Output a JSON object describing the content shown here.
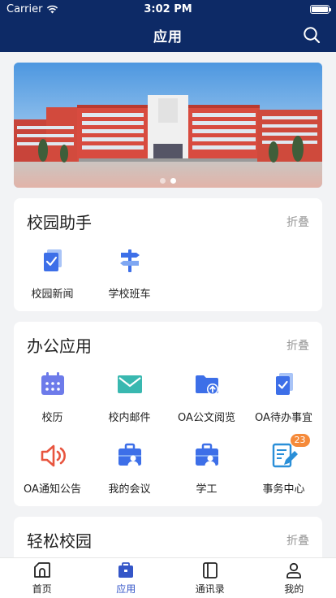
{
  "status_bar": {
    "carrier": "Carrier",
    "time": "3:02 PM"
  },
  "header": {
    "title": "应用"
  },
  "banner": {
    "dots": 2,
    "active_dot": 1
  },
  "sections": [
    {
      "title": "校园助手",
      "fold_label": "折叠",
      "items": [
        {
          "label": "校园新闻",
          "icon": "news-icon"
        },
        {
          "label": "学校班车",
          "icon": "signpost-icon"
        }
      ]
    },
    {
      "title": "办公应用",
      "fold_label": "折叠",
      "items": [
        {
          "label": "校历",
          "icon": "calendar-icon"
        },
        {
          "label": "校内邮件",
          "icon": "mail-icon"
        },
        {
          "label": "OA公文阅览",
          "icon": "folder-upload-icon"
        },
        {
          "label": "OA待办事宜",
          "icon": "todo-check-icon"
        },
        {
          "label": "OA通知公告",
          "icon": "speaker-icon"
        },
        {
          "label": "我的会议",
          "icon": "briefcase-user-icon"
        },
        {
          "label": "学工",
          "icon": "briefcase-user-icon"
        },
        {
          "label": "事务中心",
          "icon": "edit-document-icon",
          "badge": "23"
        }
      ]
    },
    {
      "title": "轻松校园",
      "fold_label": "折叠",
      "items": []
    }
  ],
  "tabs": [
    {
      "label": "首页",
      "icon": "home-icon",
      "active": false
    },
    {
      "label": "应用",
      "icon": "apps-briefcase-icon",
      "active": true
    },
    {
      "label": "通讯录",
      "icon": "contacts-book-icon",
      "active": false
    },
    {
      "label": "我的",
      "icon": "user-icon",
      "active": false
    }
  ],
  "colors": {
    "header_bg": "#0d2a66",
    "accent_blue": "#3d6fe8",
    "accent_teal": "#39b8b0",
    "accent_red": "#e8553f",
    "badge": "#f58a3a",
    "tab_active": "#3456c8"
  }
}
